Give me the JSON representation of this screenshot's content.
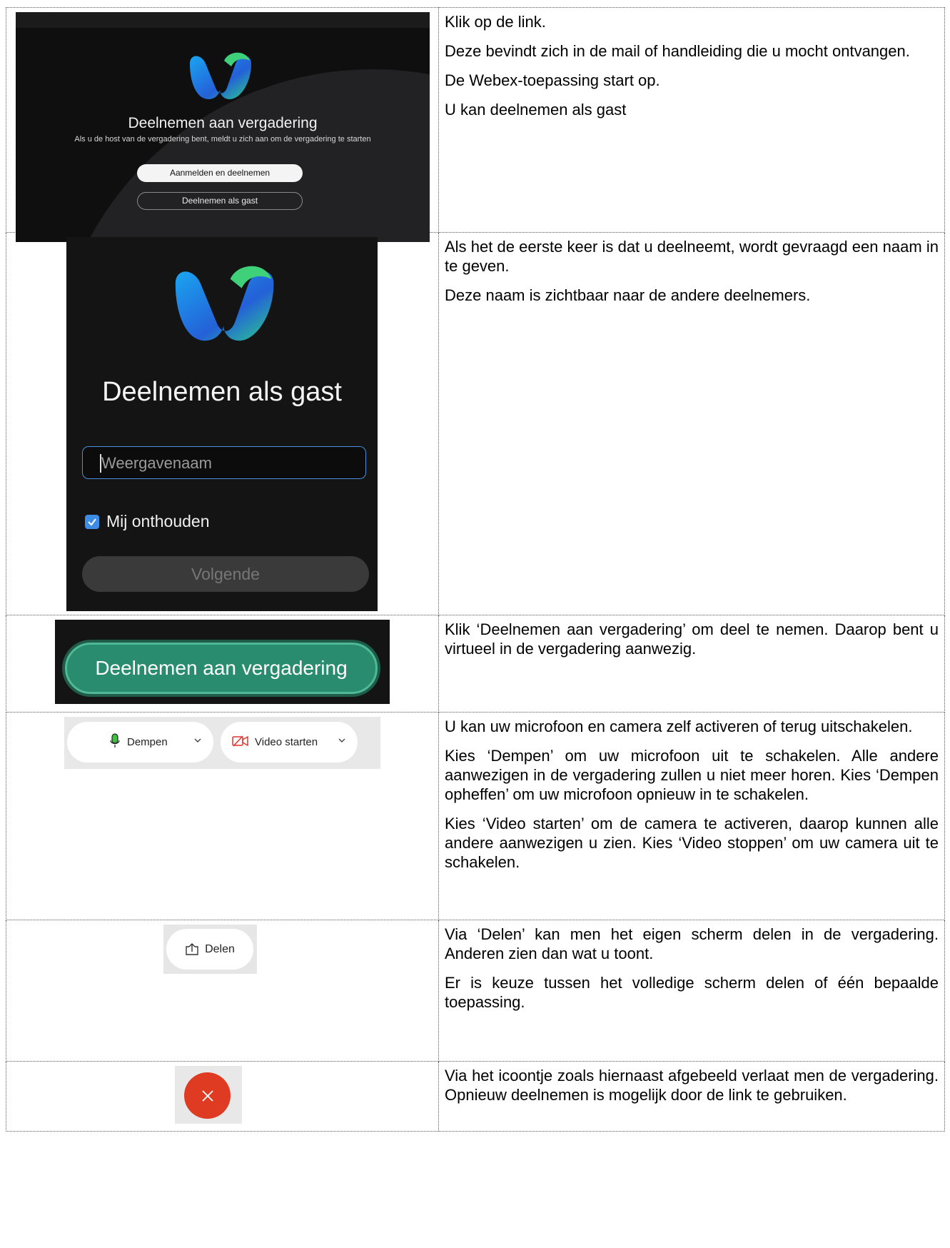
{
  "rows": [
    {
      "screenshot": {
        "title": "Deelnemen aan vergadering",
        "subtitle": "Als u de host van de vergadering bent, meldt u zich aan om de vergadering te starten",
        "primary_button": "Aanmelden en deelnemen",
        "secondary_button": "Deelnemen als gast"
      },
      "paragraphs": [
        "Klik op de link.",
        "Deze bevindt zich in de mail of handleiding die u mocht ontvangen.",
        "De Webex-toepassing start op.",
        "U kan deelnemen als gast"
      ]
    },
    {
      "screenshot": {
        "title": "Deelnemen als gast",
        "input_placeholder": "Weergavenaam",
        "checkbox_label": "Mij onthouden",
        "checkbox_checked": true,
        "next_button": "Volgende"
      },
      "paragraphs": [
        "Als het de eerste keer is dat u deelneemt, wordt gevraagd een naam in te geven.",
        "Deze naam is zichtbaar naar de andere deelnemers."
      ]
    },
    {
      "screenshot": {
        "join_button": "Deelnemen aan vergadering"
      },
      "paragraphs": [
        "Klik ‘Deelnemen aan vergadering’ om deel te nemen. Daarop bent u virtueel in de vergadering aanwezig."
      ]
    },
    {
      "screenshot": {
        "mute_button": "Dempen",
        "video_button": "Video starten"
      },
      "paragraphs": [
        "U kan uw microfoon en camera zelf activeren of terug uitschakelen.",
        "Kies ‘Dempen’ om uw microfoon uit te schakelen.  Alle andere aanwezigen in de vergadering zullen u niet meer horen.  Kies ‘Dempen opheffen’ om uw microfoon opnieuw in te schakelen.",
        "Kies ‘Video starten’ om de camera te activeren, daarop kunnen alle andere aanwezigen u zien.  Kies ‘Video stoppen’ om uw camera uit te schakelen."
      ]
    },
    {
      "screenshot": {
        "share_button": "Delen"
      },
      "paragraphs": [
        "Via ‘Delen’ kan men het eigen scherm delen in de vergadering.  Anderen zien dan wat u toont.",
        "Er is keuze tussen het volledige scherm delen of één bepaalde toepassing."
      ]
    },
    {
      "screenshot": {
        "leave_icon": "close-icon",
        "leave_color": "#de3b22"
      },
      "paragraphs": [
        "Via het icoontje zoals hiernaast afgebeeld verlaat men de vergadering.  Opnieuw deelnemen is mogelijk door de link te gebruiken."
      ]
    }
  ]
}
